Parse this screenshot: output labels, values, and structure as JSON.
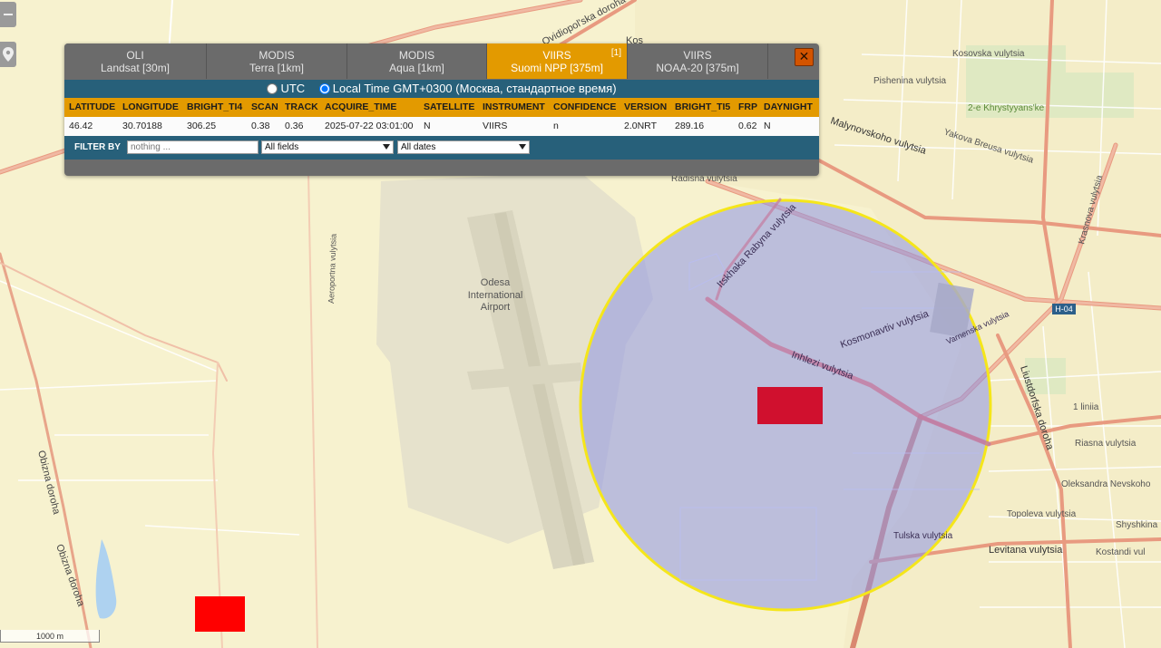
{
  "map": {
    "labels": {
      "airport": [
        "Odesa",
        "International",
        "Airport"
      ],
      "kosovska": "Kosovska vulytsia",
      "pishenina": "Pishenina vulytsia",
      "khrystyyans": "2-e Khrystyyans'ke",
      "yakova": "Yakova Breusa vulytsia",
      "malynovskoho": "Malynovskoho vulytsia",
      "radisha": "Radisna vulytsia",
      "rabyna": "Itskhaka Rabyna vulytsia",
      "kosmonavtiv": "Kosmonavtiv vulytsia",
      "inhlezi": "Inhlezi vulytsia",
      "varnenska": "Varnenska vulytsia",
      "krasnova": "Krasnova vulytsia",
      "liustdorfska": "Liustdorfska doroha",
      "h04": "H-04",
      "liniia": "1 liniia",
      "riasna": "Riasna vulytsia",
      "nevskoho": "Oleksandra Nevskoho",
      "topoleva": "Topoleva vulytsia",
      "shyshkina": "Shyshkina",
      "kostandi": "Kostandi vul",
      "levitana": "Levitana vulytsia",
      "tulska": "Tulska vulytsia",
      "ovidiopolska": "Ovidiopol'ska doroha",
      "aeroportna": "Aeroportna vulytsia",
      "obizna1": "Obizna doroha",
      "obizna2": "Obizna doroha",
      "kos_top": "Kos"
    },
    "scale_label": "1000 m"
  },
  "panel": {
    "tabs": [
      {
        "line1": "OLI",
        "line2": "Landsat [30m]",
        "active": false,
        "badge": ""
      },
      {
        "line1": "MODIS",
        "line2": "Terra [1km]",
        "active": false,
        "badge": ""
      },
      {
        "line1": "MODIS",
        "line2": "Aqua [1km]",
        "active": false,
        "badge": ""
      },
      {
        "line1": "VIIRS",
        "line2": "Suomi NPP [375m]",
        "active": true,
        "badge": "[1]"
      },
      {
        "line1": "VIIRS",
        "line2": "NOAA-20 [375m]",
        "active": false,
        "badge": ""
      }
    ],
    "close_label": "✕",
    "time": {
      "utc_label": "UTC",
      "local_label": "Local Time GMT+0300 (Москва, стандартное время)",
      "selected": "local"
    },
    "table": {
      "headers": [
        "LATITUDE",
        "LONGITUDE",
        "BRIGHT_TI4",
        "SCAN",
        "TRACK",
        "ACQUIRE_TIME",
        "SATELLITE",
        "INSTRUMENT",
        "CONFIDENCE",
        "VERSION",
        "BRIGHT_TI5",
        "FRP",
        "DAYNIGHT"
      ],
      "rows": [
        [
          "46.42",
          "30.70188",
          "306.25",
          "0.38",
          "0.36",
          "2025-07-22 03:01:00",
          "N",
          "VIIRS",
          "n",
          "2.0NRT",
          "289.16",
          "0.62",
          "N"
        ]
      ]
    },
    "filter": {
      "label": "FILTER BY",
      "placeholder": "nothing ...",
      "fields_value": "All fields",
      "dates_value": "All dates"
    }
  },
  "colors": {
    "accent": "#e39a00",
    "panel_blue": "#27607a",
    "hotspot": "#d0102e",
    "hotspot_bright": "#ff0000",
    "circle_border": "#f5e61a"
  }
}
